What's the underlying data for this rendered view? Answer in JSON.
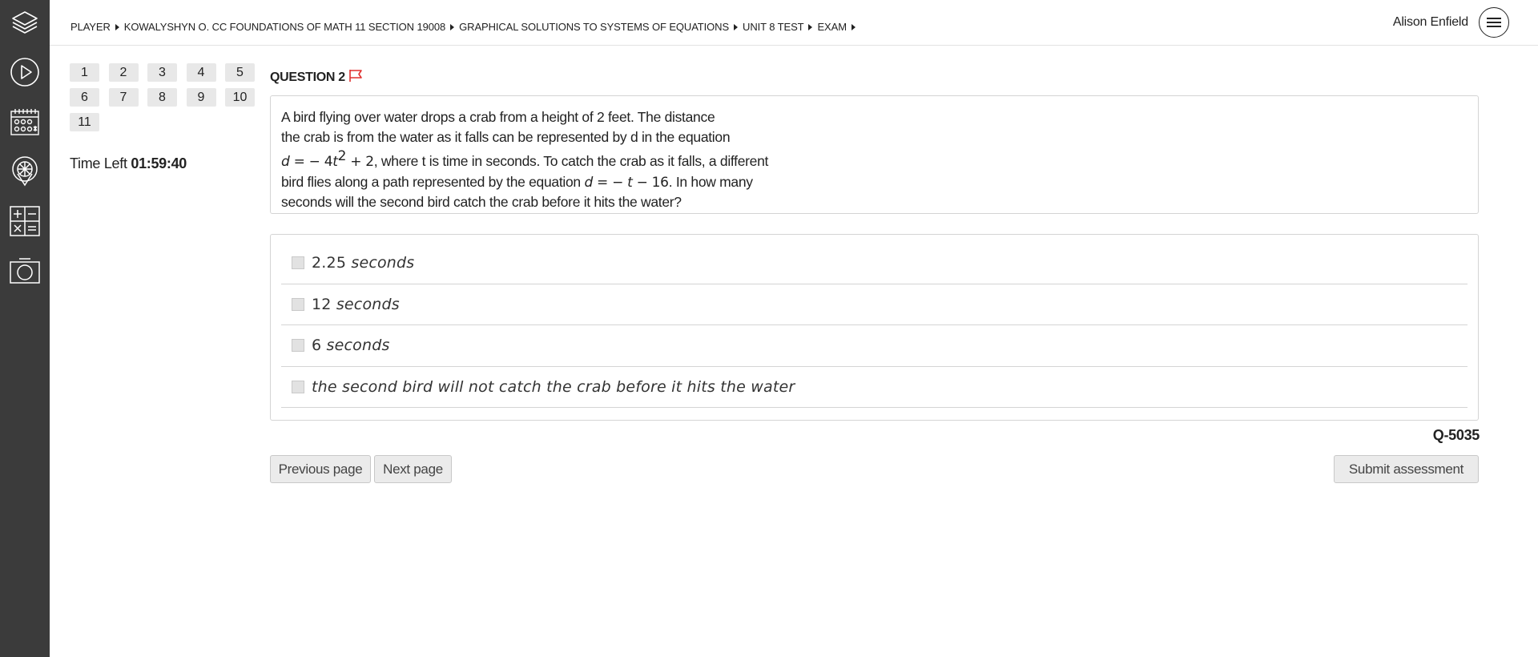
{
  "rail": {
    "items": [
      {
        "icon": "layers-icon"
      },
      {
        "icon": "play-icon"
      },
      {
        "icon": "calendar-icon"
      },
      {
        "icon": "crest-icon"
      },
      {
        "icon": "calculator-icon"
      },
      {
        "icon": "camera-icon"
      }
    ]
  },
  "header": {
    "breadcrumb": [
      "PLAYER",
      "KOWALYSHYN O. CC FOUNDATIONS OF MATH 11 SECTION 19008",
      "GRAPHICAL SOLUTIONS TO SYSTEMS OF EQUATIONS",
      "UNIT 8 TEST",
      "EXAM"
    ],
    "user_name": "Alison Enfield",
    "menu_icon": "hamburger-icon"
  },
  "question_nav": {
    "numbers": [
      "1",
      "2",
      "3",
      "4",
      "5",
      "6",
      "7",
      "8",
      "9",
      "10",
      "11"
    ]
  },
  "timer": {
    "label": "Time Left",
    "value": "01:59:40"
  },
  "question": {
    "title": "QUESTION 2",
    "flag_color": "#e0312f",
    "line1": "A bird flying over water drops a crab from a height of 2 feet. The distance",
    "line2": "the crab is from the water as it falls can be represented by d in the equation",
    "eq1_lhs": "d",
    "eq1_mid": " = − 4",
    "eq1_t": "t",
    "eq1_exp": "2",
    "eq1_rhs": " + 2",
    "line3_rest": ", where t is time in seconds. To catch the crab as it falls, a different",
    "line4_start": "bird flies along a path represented by the equation ",
    "eq2_d": "d",
    "eq2_eq": " = − ",
    "eq2_t": "t",
    "eq2_rhs": " − 16",
    "line4_end": ". In how many",
    "line5": "seconds will the second bird catch the crab before it hits the water?"
  },
  "answers": [
    {
      "num": "2.25",
      "text": " seconds"
    },
    {
      "num": "12",
      "text": " seconds"
    },
    {
      "num": "6",
      "text": " seconds"
    },
    {
      "num": "",
      "text": "the second bird will not catch the crab before it hits the water"
    }
  ],
  "question_id": "Q-5035",
  "buttons": {
    "previous": "Previous page",
    "next": "Next page",
    "submit": "Submit assessment"
  }
}
